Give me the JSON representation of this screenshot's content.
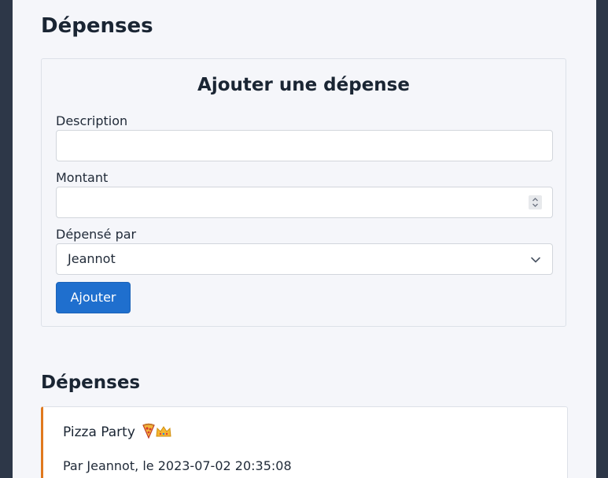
{
  "page": {
    "title": "Dépenses"
  },
  "form": {
    "title": "Ajouter une dépense",
    "description_label": "Description",
    "description_value": "",
    "amount_label": "Montant",
    "amount_value": "",
    "spent_by_label": "Dépensé par",
    "spent_by_selected": "Jeannot",
    "submit_label": "Ajouter"
  },
  "expenses": {
    "title": "Dépenses",
    "items": [
      {
        "title": "Pizza Party",
        "emoji": "🍕👑",
        "meta_prefix": "Par",
        "author": "Jeannot",
        "date_prefix": "le",
        "date": "2023-07-02 20:35:08",
        "accent_color": "#e0791e"
      }
    ]
  },
  "colors": {
    "primary": "#1f6fce",
    "sidebar_dark": "#2d3748",
    "page_bg": "#f5f6fa",
    "accent_orange": "#e0791e"
  },
  "icons": {
    "spinner": "spinner-arrows-icon",
    "select": "chevron-down-icon"
  }
}
